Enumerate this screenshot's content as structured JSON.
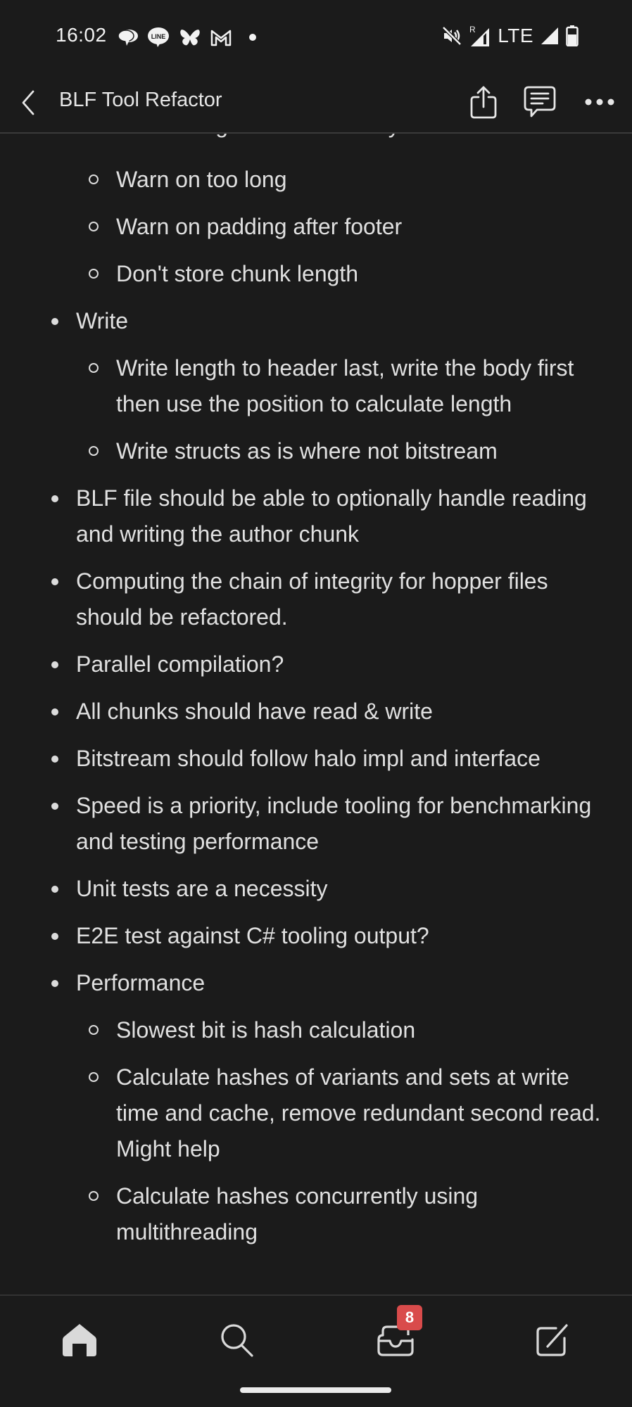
{
  "status_bar": {
    "time": "16:02",
    "notification_icons": [
      "messages-icon",
      "line-icon",
      "bluesky-icon",
      "gmail-icon",
      "more-notifications-dot"
    ],
    "line_label": "LINE",
    "roaming_label": "R",
    "network_label": "LTE",
    "system_icons": [
      "mute-icon",
      "roaming-signal-icon",
      "signal-icon",
      "battery-icon"
    ]
  },
  "app_bar": {
    "title": "BLF Tool Refactor",
    "actions": [
      "share",
      "comments",
      "more"
    ]
  },
  "content": {
    "clipped_top_line": "Assert length == sizeof body + head",
    "items": [
      {
        "level": 2,
        "text": "Warn on too long"
      },
      {
        "level": 2,
        "text": "Warn on padding after footer"
      },
      {
        "level": 2,
        "text": "Don't store chunk length"
      },
      {
        "level": 1,
        "text": "Write"
      },
      {
        "level": 2,
        "text": "Write length to header last, write the body first then use the position to calculate length"
      },
      {
        "level": 2,
        "text": "Write structs as is where not bitstream"
      },
      {
        "level": 1,
        "text": "BLF file should be able to optionally handle reading and writing the author chunk"
      },
      {
        "level": 1,
        "text": "Computing the chain of integrity for hopper files should be refactored."
      },
      {
        "level": 1,
        "text": "Parallel compilation?"
      },
      {
        "level": 1,
        "text": "All chunks should have read & write"
      },
      {
        "level": 1,
        "text": "Bitstream should follow halo impl and interface"
      },
      {
        "level": 1,
        "text": "Speed is a priority, include tooling for benchmarking and testing performance"
      },
      {
        "level": 1,
        "text": "Unit tests are a necessity"
      },
      {
        "level": 1,
        "text": "E2E test against C# tooling output?"
      },
      {
        "level": 1,
        "text": "Performance"
      },
      {
        "level": 2,
        "text": "Slowest bit is hash calculation"
      },
      {
        "level": 2,
        "text": "Calculate hashes of variants and sets at write time and cache, remove redundant second read. Might help"
      },
      {
        "level": 2,
        "text": "Calculate hashes concurrently using multithreading"
      }
    ]
  },
  "bottom_nav": {
    "items": [
      "home",
      "search",
      "inbox",
      "compose"
    ],
    "active": "home",
    "inbox_badge": "8"
  },
  "colors": {
    "background": "#1b1b1b",
    "text": "#e0e0e0",
    "badge": "#d94b4b"
  }
}
